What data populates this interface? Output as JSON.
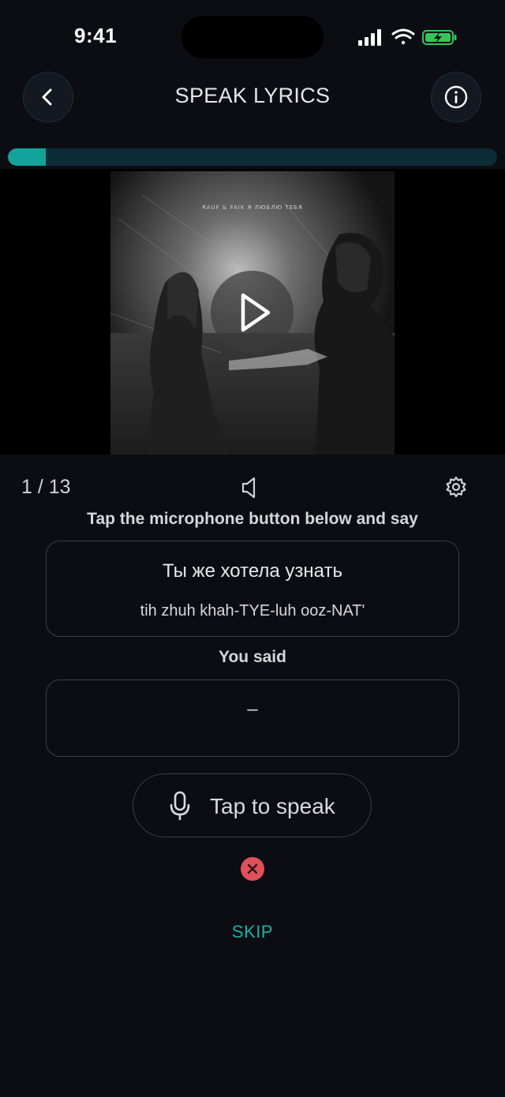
{
  "status_bar": {
    "time": "9:41"
  },
  "header": {
    "title": "SPEAK LYRICS"
  },
  "progress": {
    "value": 0.077
  },
  "album": {
    "caption": "RAUF & FAIK  Я ЛЮБЛЮ ТЕБЯ"
  },
  "lesson": {
    "counter": "1 / 13",
    "instruction": "Tap the microphone button below and say",
    "target_text": "Ты же хотела узнать",
    "transliteration": "tih zhuh khah-TYE-luh ooz-NAT'",
    "you_said_label": "You said",
    "you_said_value": "–",
    "tap_label": "Tap to speak",
    "skip_label": "SKIP"
  },
  "colors": {
    "accent": "#14a39a",
    "progress_track": "#0e2c38",
    "error": "#e0505a",
    "background": "#0b0d12"
  },
  "icons": [
    "back-chevron-icon",
    "info-icon",
    "play-icon",
    "speaker-icon",
    "gear-icon",
    "microphone-icon",
    "close-icon"
  ]
}
